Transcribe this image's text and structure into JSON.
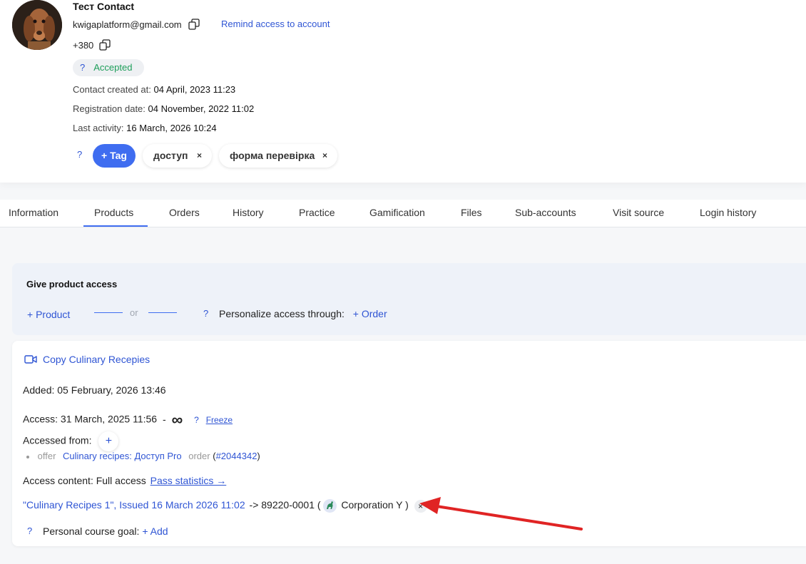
{
  "contact": {
    "name": "Тест Contact",
    "email": "kwigaplatform@gmail.com",
    "phone": "+380",
    "remind_label": "Remind access to account",
    "status_q": "?",
    "status": "Accepted",
    "created_label": "Contact created at:",
    "created_value": "04 April, 2023 11:23",
    "registration_label": "Registration date:",
    "registration_value": "04 November, 2022 11:02",
    "activity_label": "Last activity:",
    "activity_value": "16 March, 2026 10:24",
    "tags_q": "?",
    "tag_button": "+ Tag",
    "tags": [
      "доступ",
      "форма перевірка"
    ],
    "tag_remove": "×"
  },
  "tabs": [
    "Information",
    "Products",
    "Orders",
    "History",
    "Practice",
    "Gamification",
    "Files",
    "Sub-accounts",
    "Visit source",
    "Login history"
  ],
  "active_tab": "Products",
  "give_access": {
    "title": "Give product access",
    "product_link": "+ Product",
    "or": "or",
    "q": "?",
    "personalize": "Personalize access through:",
    "order_link": "+ Order"
  },
  "product": {
    "title": "Copy Culinary Recepies",
    "added_label": "Added:",
    "added_value": "05 February, 2026 13:46",
    "access_label": "Access:",
    "access_value": "31 March, 2025 11:56",
    "access_dash": "-",
    "access_infinity": "∞",
    "freeze_q": "?",
    "freeze": "Freeze",
    "accessed_from_label": "Accessed from:",
    "add_plus": "+",
    "offer_label": "offer",
    "offer_link": "Culinary recipes: Доступ Pro",
    "order_label": "order",
    "order_open": "(",
    "order_link": "#2044342",
    "order_close": ")",
    "content_label": "Access content:",
    "content_value": "Full access",
    "pass_stats": "Pass statistics →",
    "certificate_link": "\"Culinary Recipes 1\", Issued 16 March 2026 11:02",
    "certificate_arrow": "->",
    "certificate_number": "89220-0001",
    "paren_open": "(",
    "corporation": "Corporation Y",
    "paren_close": ")",
    "remove": "×",
    "goal_q": "?",
    "goal_label": "Personal course goal:",
    "goal_add": "+ Add"
  },
  "colors": {
    "accent": "#3f6df0",
    "link": "#2f55d4",
    "accepted": "#1e9e5a",
    "annotation_arrow": "#e02424"
  }
}
